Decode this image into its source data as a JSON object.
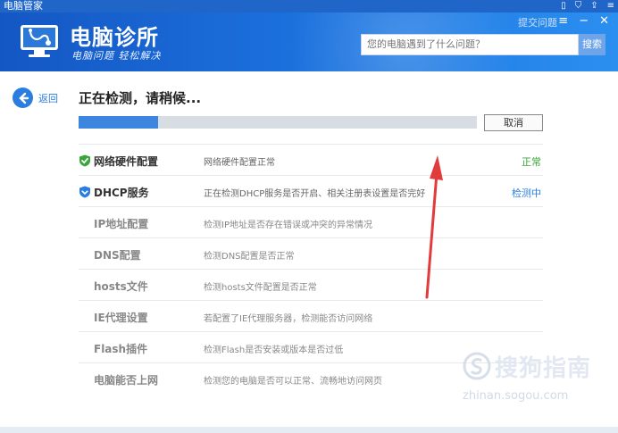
{
  "window": {
    "title": "电脑管家"
  },
  "header": {
    "app_name": "电脑诊所",
    "slogan": "电脑问题 轻松解决",
    "feedback_link": "提交问题",
    "search": {
      "placeholder": "您的电脑遇到了什么问题？",
      "button": "搜索"
    }
  },
  "nav": {
    "back_label": "返回"
  },
  "scan": {
    "title": "正在检测，请稍候...",
    "progress": 0.2,
    "cancel_label": "取消"
  },
  "items": [
    {
      "name": "网络硬件配置",
      "desc": "网络硬件配置正常",
      "state": "正常",
      "icon": "shield-check-icon",
      "state_color": "#3aa53a"
    },
    {
      "name": "DHCP服务",
      "desc": "正在检测DHCP服务是否开启、相关注册表设置是否完好",
      "state": "检测中",
      "icon": "shield-blue-icon",
      "state_color": "#2a7ee0"
    },
    {
      "name": "IP地址配置",
      "desc": "检测IP地址是否存在错误或冲突的异常情况",
      "state": ""
    },
    {
      "name": "DNS配置",
      "desc": "检测DNS配置是否正常",
      "state": ""
    },
    {
      "name": "hosts文件",
      "desc": "检测hosts文件配置是否正常",
      "state": ""
    },
    {
      "name": "IE代理设置",
      "desc": "若配置了IE代理服务器，检测能否访问网络",
      "state": ""
    },
    {
      "name": "Flash插件",
      "desc": "检测Flash是否安装或版本是否过低",
      "state": ""
    },
    {
      "name": "电脑能否上网",
      "desc": "检测您的电脑是否可以正常、流畅地访问网页",
      "state": ""
    }
  ],
  "watermark": {
    "brand": "搜狗指南",
    "url": "zhinan.sogou.com"
  },
  "colors": {
    "accent": "#2a7ee0",
    "ok": "#3aa53a",
    "annotation": "#e23b3b"
  }
}
